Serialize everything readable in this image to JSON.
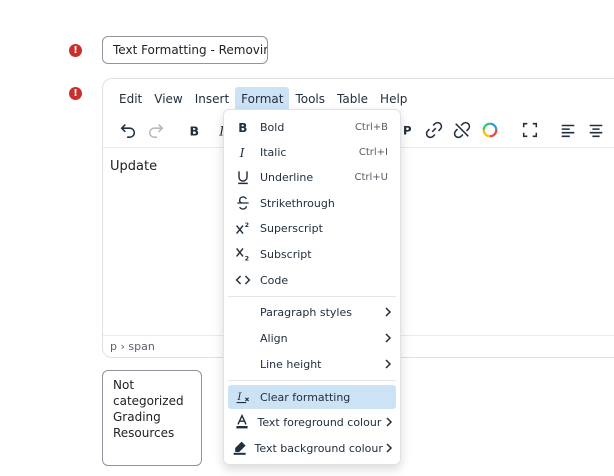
{
  "title_field": {
    "value": "Text Formatting - Removing"
  },
  "editor": {
    "menubar": [
      "Edit",
      "View",
      "Insert",
      "Format",
      "Tools",
      "Table",
      "Help"
    ],
    "active_menu": "Format",
    "content": "Update",
    "statusbar_path": "p › span"
  },
  "category_list": [
    "Not categorized",
    "Grading",
    "Resources"
  ],
  "format_menu": {
    "bold": {
      "label": "Bold",
      "shortcut": "Ctrl+B"
    },
    "italic": {
      "label": "Italic",
      "shortcut": "Ctrl+I"
    },
    "underline": {
      "label": "Underline",
      "shortcut": "Ctrl+U"
    },
    "strikethrough": {
      "label": "Strikethrough"
    },
    "superscript": {
      "label": "Superscript"
    },
    "subscript": {
      "label": "Subscript"
    },
    "code": {
      "label": "Code"
    },
    "paragraph_styles": {
      "label": "Paragraph styles"
    },
    "align": {
      "label": "Align"
    },
    "line_height": {
      "label": "Line height"
    },
    "clear_formatting": {
      "label": "Clear formatting"
    },
    "text_foreground": {
      "label": "Text foreground colour"
    },
    "text_background": {
      "label": "Text background colour"
    }
  },
  "colors": {
    "accent_hover": "#cce3f5",
    "error": "#c9302c",
    "text": "#222f3e"
  }
}
